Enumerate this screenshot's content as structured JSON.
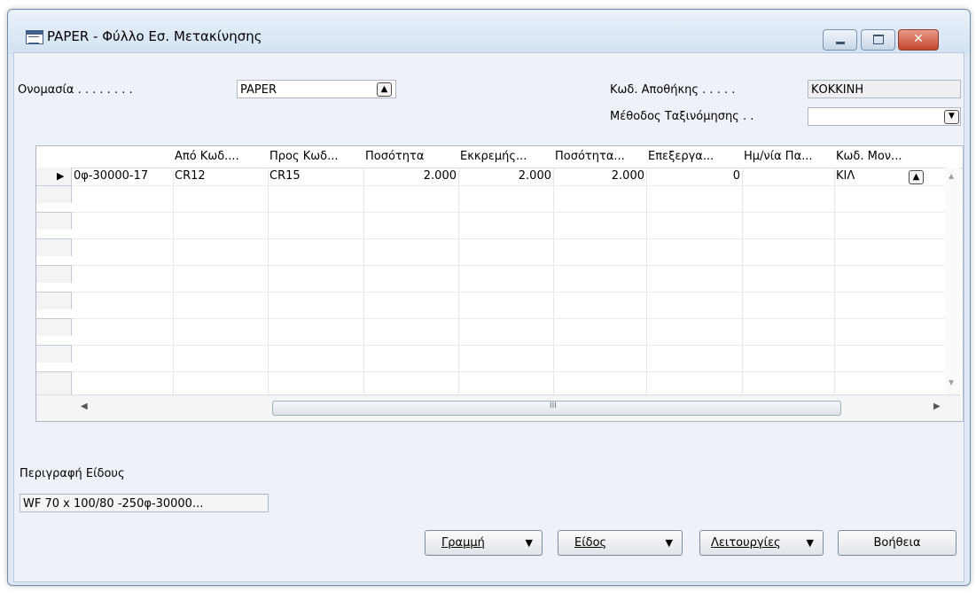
{
  "window": {
    "title": "PAPER - Φύλλο Εσ. Μετακίνησης",
    "close_glyph": "✕"
  },
  "header": {
    "name_label": "Ονομασία . . . . . . . .",
    "name_value": "PAPER",
    "warehouse_label": "Κωδ. Αποθήκης . . . . .",
    "warehouse_value": "ΚΟΚΚΙΝΗ",
    "sort_label": "Μέθοδος Ταξινόμησης . .",
    "sort_value": ""
  },
  "grid": {
    "columns": [
      "",
      "Από Κωδ....",
      "Προς Κωδ...",
      "Ποσότητα",
      "Εκκρεμής...",
      "Ποσότητα...",
      "Επεξεργα...",
      "Ημ/νία Πα...",
      "Κωδ. Μον..."
    ],
    "rows": [
      [
        "0φ-30000-17",
        "CR12",
        "CR15",
        "2.000",
        "2.000",
        "2.000",
        "0",
        "",
        "ΚΙΛ"
      ]
    ],
    "current_row_marker": "▶",
    "hscroll_mark": "III"
  },
  "description": {
    "label": "Περιγραφή Είδους",
    "value": "WF 70 x 100/80 -250φ-30000..."
  },
  "buttons": {
    "line": "Γραμμή",
    "item": "Είδος",
    "functions": "Λειτουργίες",
    "help": "Βοήθεια",
    "arrow": "▼"
  },
  "icons": {
    "lookup": "lookup-arrow-icon",
    "dropdown": "dropdown-arrow-icon"
  }
}
